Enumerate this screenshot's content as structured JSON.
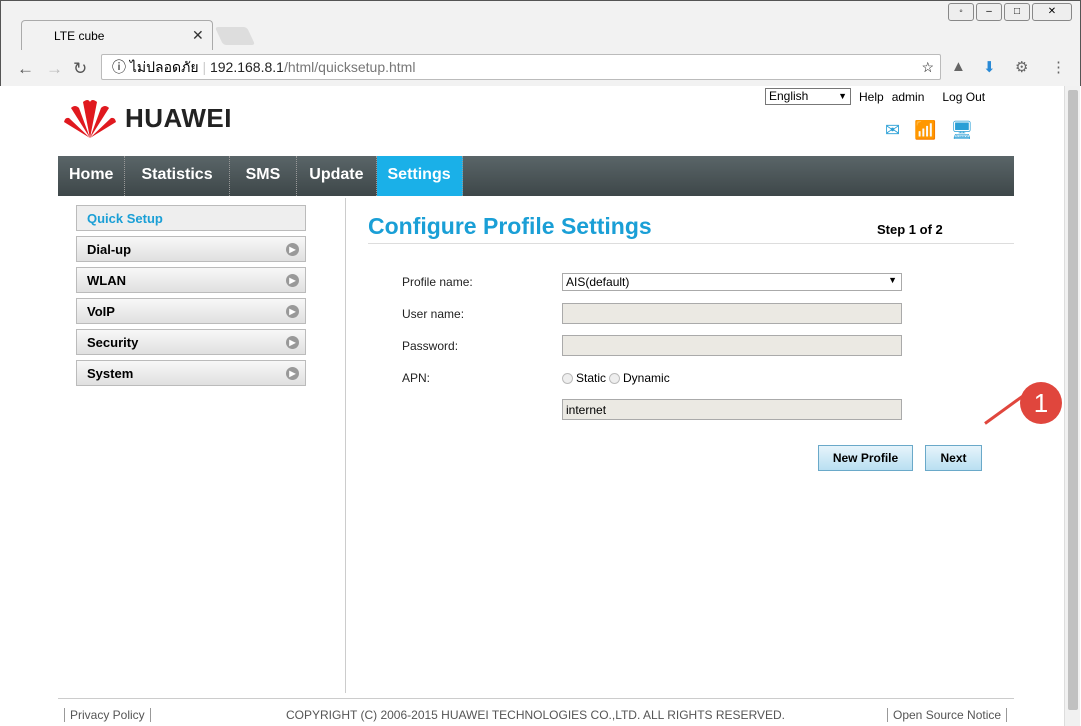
{
  "browser": {
    "tab_title": "LTE cube",
    "security": "ไม่ปลอดภัย",
    "url_host": "192.168.8.1",
    "url_path": "/html/quicksetup.html"
  },
  "header": {
    "language": "English",
    "help": "Help",
    "user": "admin",
    "logout": "Log Out",
    "brand": "HUAWEI"
  },
  "menu": [
    "Home",
    "Statistics",
    "SMS",
    "Update",
    "Settings"
  ],
  "sidebar": [
    "Quick Setup",
    "Dial-up",
    "WLAN",
    "VoIP",
    "Security",
    "System"
  ],
  "main": {
    "title": "Configure Profile Settings",
    "step": "Step 1 of 2",
    "profile_label": "Profile name:",
    "profile_value": "AIS(default)",
    "user_label": "User name:",
    "password_label": "Password:",
    "apn_label": "APN:",
    "apn_static": "Static",
    "apn_dynamic": "Dynamic",
    "apn_value": "internet",
    "new_profile": "New Profile",
    "next": "Next"
  },
  "annotation": "1",
  "footer": {
    "privacy": "Privacy Policy",
    "copyright": "COPYRIGHT (C) 2006-2015 HUAWEI TECHNOLOGIES CO.,LTD. ALL RIGHTS RESERVED.",
    "opensource": "Open Source Notice"
  },
  "colors": {
    "accent": "#1a9fd6",
    "annotation": "#e0463d"
  }
}
